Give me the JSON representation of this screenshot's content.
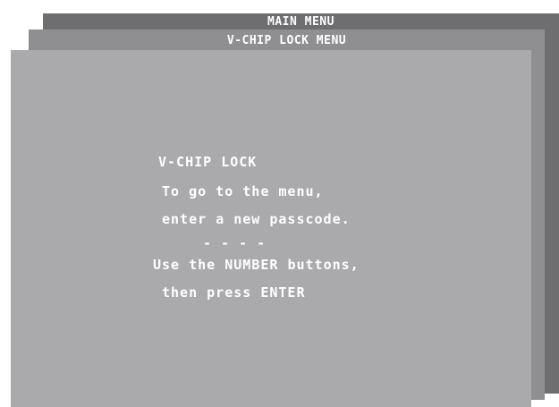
{
  "menus": {
    "main_menu_title": "MAIN MENU",
    "vchip_menu_title": "V-CHIP LOCK MENU"
  },
  "panel": {
    "heading": "V-CHIP LOCK",
    "line1": "To go to the menu,",
    "line2": "enter a new passcode.",
    "passcode_placeholder": "- - - -",
    "instruction1": "Use the NUMBER buttons,",
    "instruction2": "then press ENTER"
  },
  "colors": {
    "main_menu_bg": "#6e6e70",
    "vchip_menu_bg": "#8f8f92",
    "panel_bg": "#aaaaad",
    "text": "#ffffff"
  }
}
